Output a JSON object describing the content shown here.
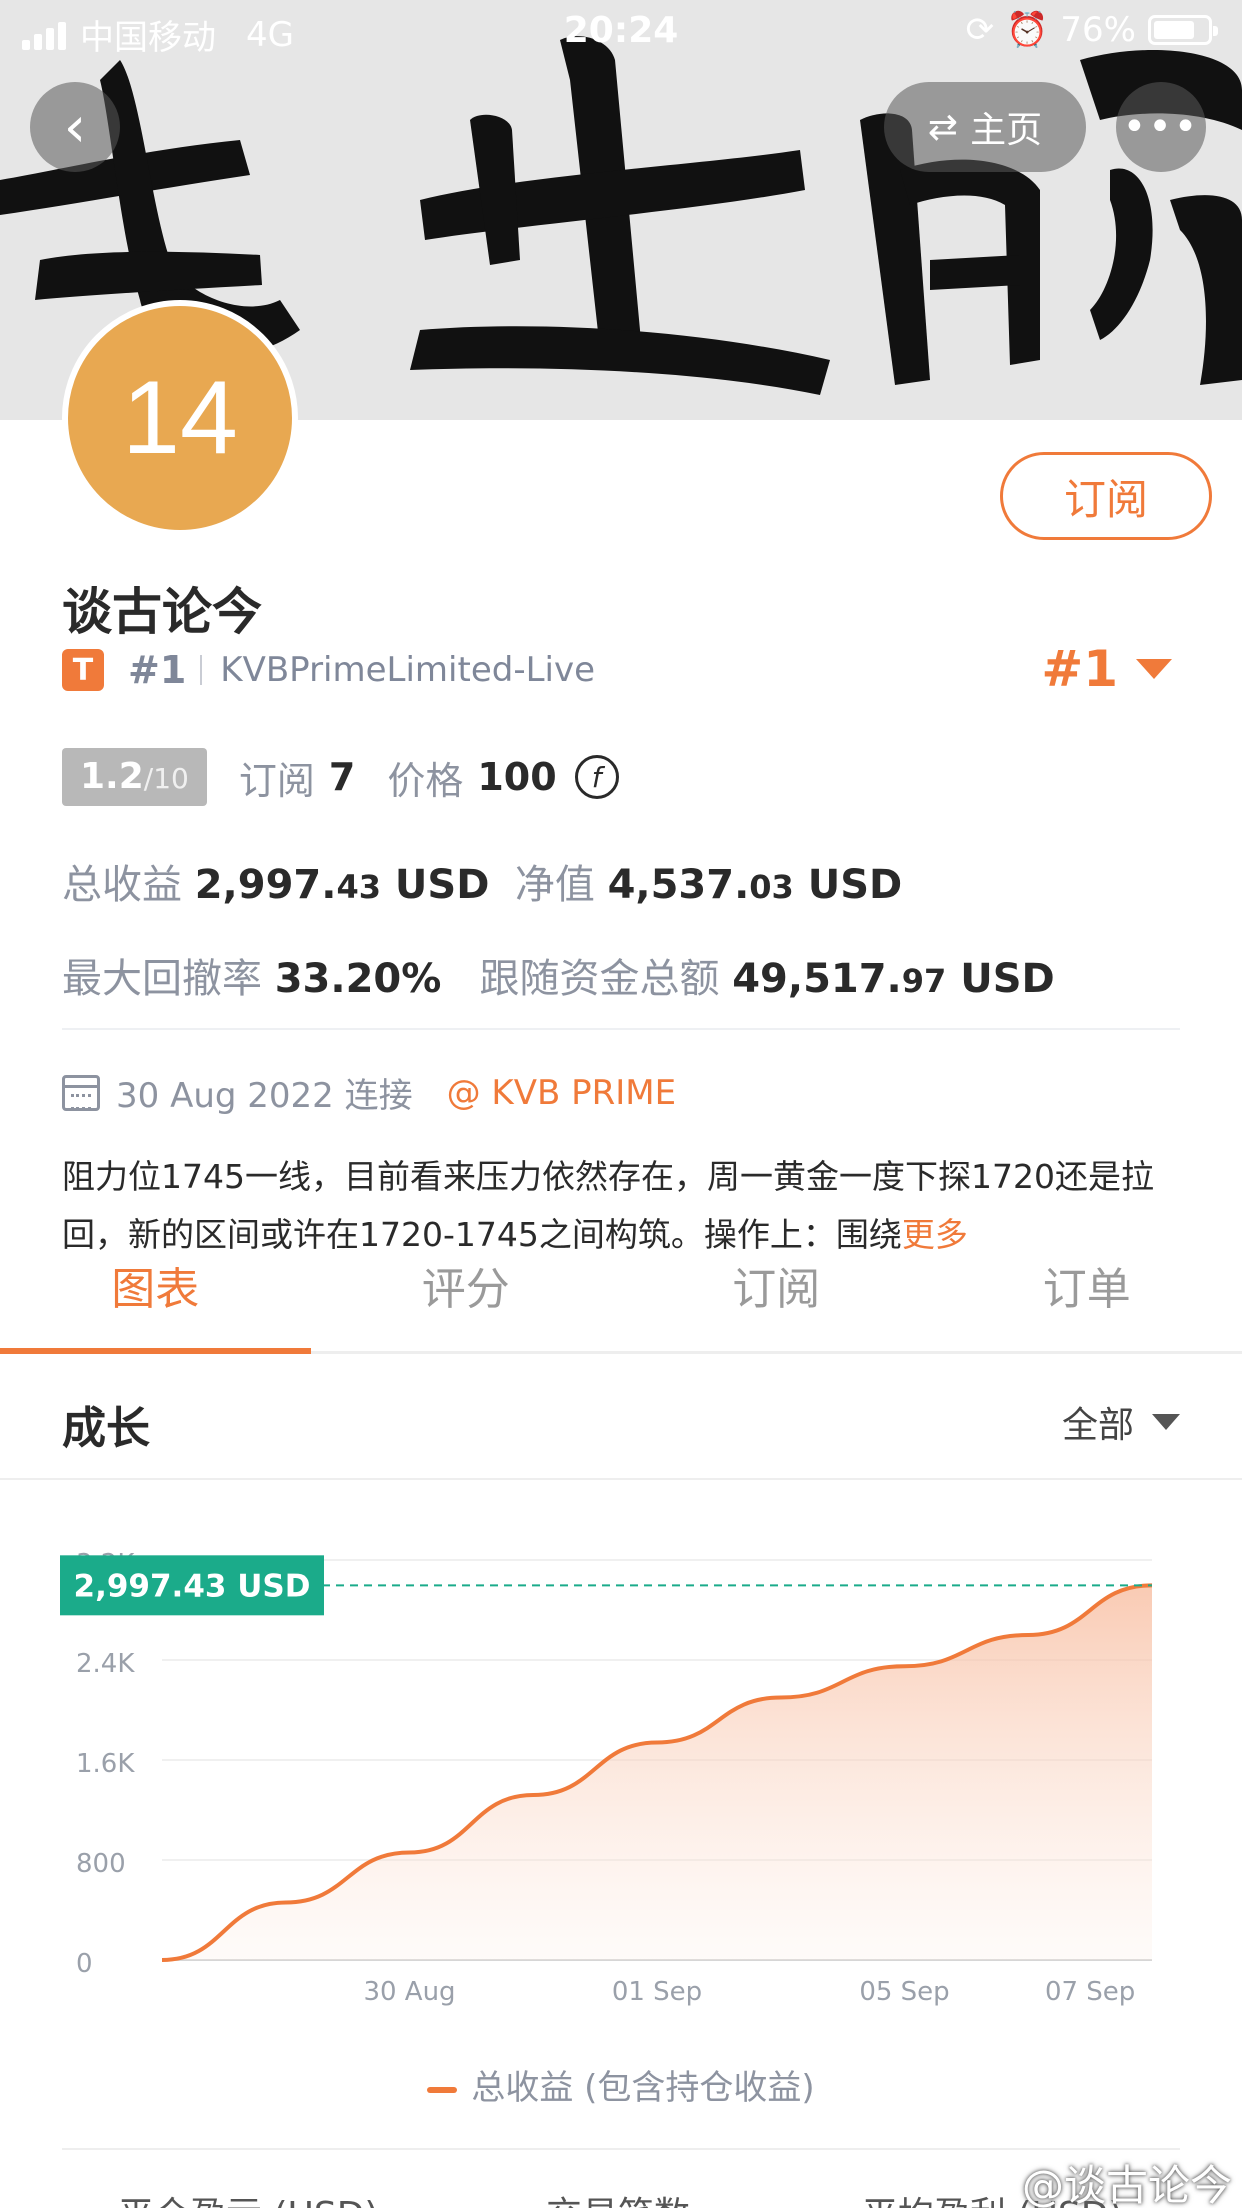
{
  "status_bar": {
    "carrier": "中国移动",
    "network": "4G",
    "time": "20:24",
    "battery": "76%",
    "battery_level": 0.76
  },
  "nav": {
    "home_label": "主页"
  },
  "profile": {
    "avatar_text": "14",
    "name": "谈古论今",
    "badge_letter": "T",
    "rank_small": "#1",
    "account": "KVBPrimeLimited-Live",
    "rank_big": "#1",
    "subscribe_label": "订阅",
    "score_value": "1.2",
    "score_max": "/10",
    "subscribe_count_label": "订阅",
    "subscribe_count": "7",
    "price_label": "价格",
    "price": "100",
    "coin_symbol": "f"
  },
  "stats": {
    "total_profit_label": "总收益",
    "total_profit_int": "2,997.",
    "total_profit_dec": "43",
    "total_profit_unit": "USD",
    "net_label": "净值",
    "net_int": "4,537.",
    "net_dec": "03",
    "net_unit": "USD",
    "drawdown_label": "最大回撤率",
    "drawdown": "33.20%",
    "follow_label": "跟随资金总额",
    "follow_int": "49,517.",
    "follow_dec": "97",
    "follow_unit": "USD"
  },
  "connect": {
    "date": "30 Aug 2022 连接",
    "broker": "@ KVB PRIME"
  },
  "description": {
    "text": "阻力位1745一线，目前看来压力依然存在，周一黄金一度下探1720还是拉回，新的区间或许在1720-1745之间构筑。操作上：围绕",
    "more": "更多"
  },
  "tabs": [
    "图表",
    "评分",
    "订阅",
    "订单"
  ],
  "section": {
    "title": "成长",
    "filter": "全部"
  },
  "chart_data": {
    "type": "area",
    "y_ticks": [
      "0",
      "800",
      "1.6K",
      "2.4K",
      "3.2K"
    ],
    "ylim": [
      0,
      3200
    ],
    "x_ticks": [
      "30 Aug",
      "01 Sep",
      "05 Sep",
      "07 Sep"
    ],
    "x_tick_positions": [
      2,
      4,
      6,
      7.5
    ],
    "x": [
      0,
      1,
      2,
      3,
      4,
      5,
      6,
      7,
      8
    ],
    "values": [
      0,
      460,
      860,
      1320,
      1740,
      2100,
      2350,
      2600,
      2997.43
    ],
    "highlight_label": "2,997.43 USD",
    "highlight_value": 2997.43,
    "line_color": "#f07a3a",
    "highlight_color": "#1bab8a",
    "legend": "总收益 (包含持仓收益)"
  },
  "bottom_labels": [
    "平仓盈亏 (USD)",
    "交易笔数",
    "平均盈利 (USD)"
  ],
  "watermark": "@谈古论今"
}
